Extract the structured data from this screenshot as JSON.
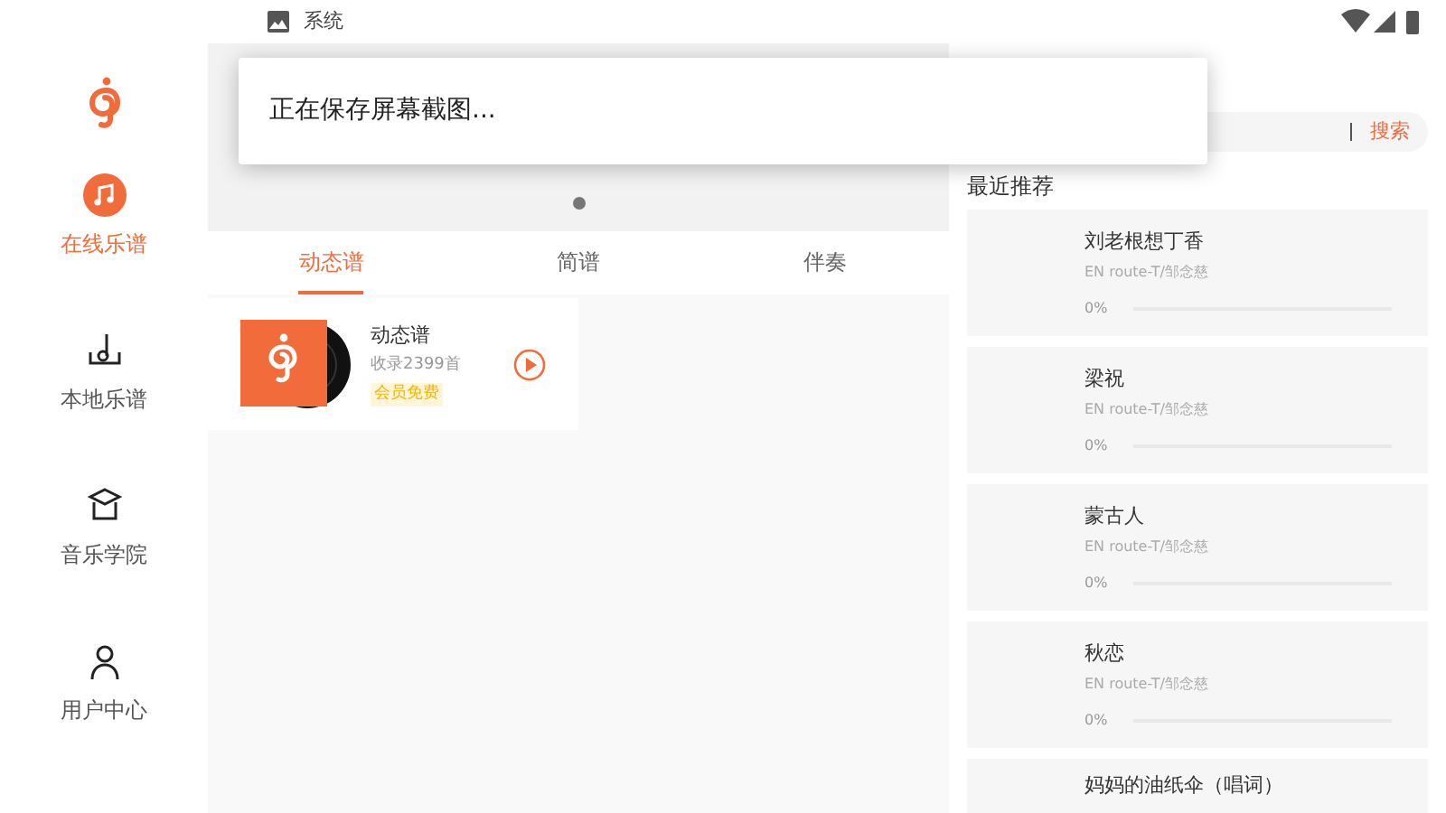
{
  "status_bar": {
    "notification": "系统"
  },
  "toast": {
    "text": "正在保存屏幕截图..."
  },
  "sidebar": {
    "items": [
      {
        "label": "在线乐谱",
        "selected": true,
        "kind": "online"
      },
      {
        "label": "本地乐谱",
        "selected": false,
        "kind": "local"
      },
      {
        "label": "音乐学院",
        "selected": false,
        "kind": "school"
      },
      {
        "label": "用户中心",
        "selected": false,
        "kind": "user"
      }
    ]
  },
  "tabs": [
    {
      "label": "动态谱",
      "selected": true
    },
    {
      "label": "简谱",
      "selected": false
    },
    {
      "label": "伴奏",
      "selected": false
    }
  ],
  "score_card": {
    "title": "动态谱",
    "count": "收录2399首",
    "badge": "会员免费"
  },
  "search": {
    "button": "搜索"
  },
  "recent": {
    "title": "最近推荐",
    "items": [
      {
        "title": "刘老根想丁香",
        "artist": "EN route-T/邹念慈",
        "reading": "0%"
      },
      {
        "title": "梁祝",
        "artist": "EN route-T/邹念慈",
        "reading": "0%"
      },
      {
        "title": "蒙古人",
        "artist": "EN route-T/邹念慈",
        "reading": "0%"
      },
      {
        "title": "秋恋",
        "artist": "EN route-T/邹念慈",
        "reading": "0%"
      },
      {
        "title": "妈妈的油纸伞（唱词）"
      }
    ]
  }
}
